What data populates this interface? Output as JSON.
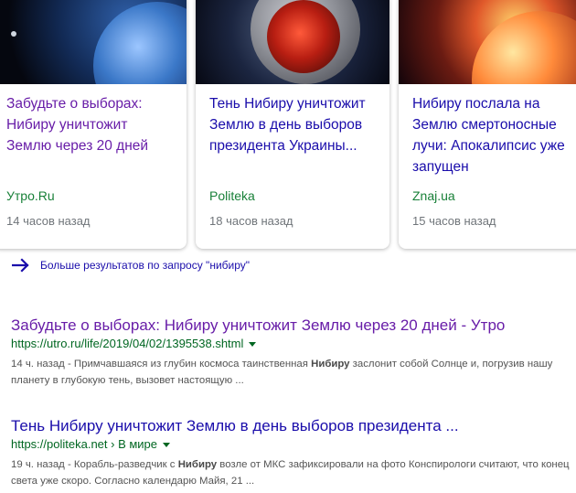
{
  "top_stories": [
    {
      "title": "Забудьте о выборах: Нибиру уничтожит Землю через 20 дней",
      "source": "Утро.Ru",
      "time": "14 часов назад",
      "thumbnail_icon": "earth-image"
    },
    {
      "title": "Тень Нибиру уничтожит Землю в день выборов президента Украины...",
      "source": "Politeka",
      "time": "18 часов назад",
      "thumbnail_icon": "planet-eclipse-image"
    },
    {
      "title": "Нибиру послала на Землю смертоносные лучи: Апокалипсис уже запущен",
      "source": "Znaj.ua",
      "time": "15 часов назад",
      "thumbnail_icon": "planet-explosion-image"
    }
  ],
  "more_results": {
    "label": "Больше результатов по запросу \"нибиру\"",
    "icon": "arrow-right-icon"
  },
  "results": [
    {
      "title": "Забудьте о выборах: Нибиру уничтожит Землю через 20 дней - Утро",
      "url": "https://utro.ru/life/2019/04/02/1395538.shtml",
      "snippet_prefix": "14 ч. назад - Примчавшаяся из глубин космоса таинственная ",
      "snippet_bold": "Нибиру",
      "snippet_suffix": " заслонит собой Солнце и, погрузив нашу планету в глубокую тень, вызовет настоящую ..."
    },
    {
      "title": "Тень Нибиру уничтожит Землю в день выборов президента ...",
      "url": "https://politeka.net › В мире",
      "snippet_prefix": "19 ч. назад - Корабль-разведчик с ",
      "snippet_bold": "Нибиру",
      "snippet_suffix": " возле от МКС зафиксировали на фото Конспирологи считают, что конец света уже скоро. Согласно календарю Майя, 21 ..."
    }
  ],
  "colors": {
    "link_visited": "#681da8",
    "link": "#1a0dab",
    "source_green": "#188038",
    "url_green": "#006621",
    "meta_gray": "#70757a",
    "snippet_gray": "#545454"
  }
}
